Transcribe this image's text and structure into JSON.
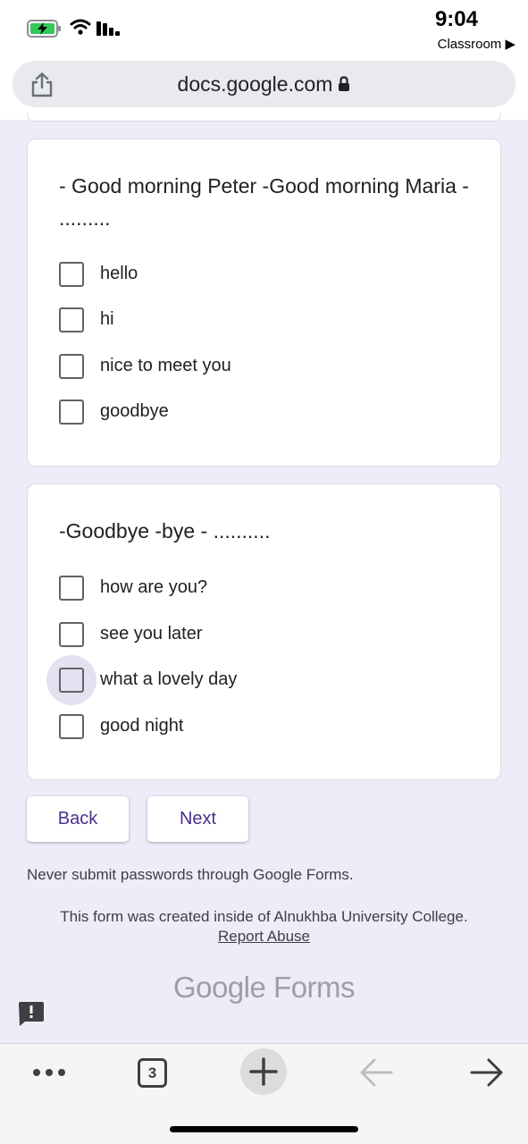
{
  "status_bar": {
    "time": "9:04",
    "back_app": "Classroom ▶",
    "icons": [
      "battery-charging-icon",
      "wifi-icon",
      "cellular-signal-icon"
    ]
  },
  "browser": {
    "url": "docs.google.com",
    "icons": [
      "share-icon",
      "lock-icon"
    ]
  },
  "questions": [
    {
      "title": "- Good morning Peter -Good morning Maria - .........",
      "options": [
        "hello",
        "hi",
        "nice to meet you",
        "goodbye"
      ],
      "checked": [
        false,
        false,
        false,
        false
      ]
    },
    {
      "title": "-Goodbye -bye - ..........",
      "options": [
        "how are you?",
        "see you later",
        "what a lovely day",
        "good night"
      ],
      "checked": [
        false,
        false,
        false,
        false
      ]
    }
  ],
  "buttons": {
    "back": "Back",
    "next": "Next"
  },
  "footer": {
    "warning": "Never submit passwords through Google Forms.",
    "created": "This form was created inside of Alnukhba University College.",
    "report": "Report Abuse",
    "brand": "Google Forms"
  },
  "toolbar": {
    "tabs_count": "3",
    "icons": [
      "more-icon",
      "tabs-icon",
      "new-tab-plus-icon",
      "back-arrow-icon",
      "forward-arrow-icon"
    ]
  },
  "colors": {
    "page_background": "#f0ebf8",
    "accent": "#4a2f8f",
    "battery_green": "#34c759"
  }
}
